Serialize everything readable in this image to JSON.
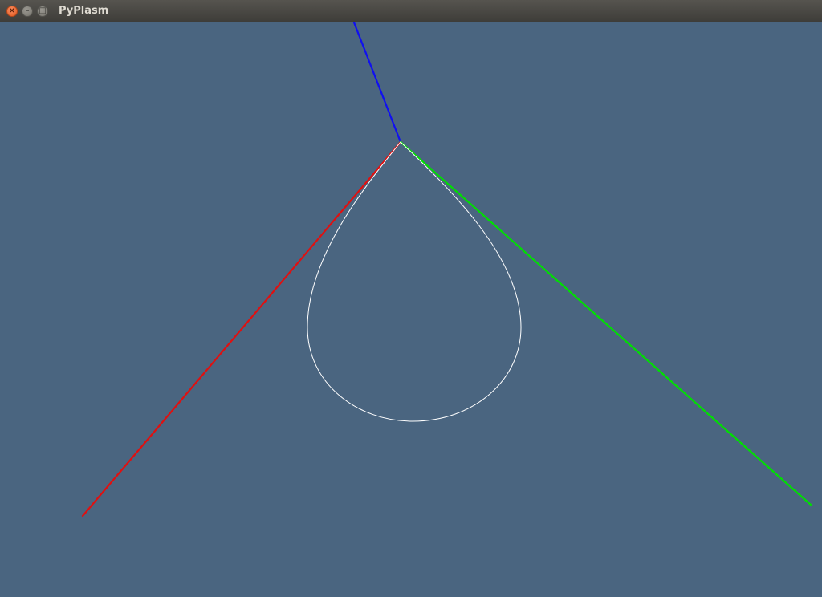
{
  "window": {
    "title": "PyPlasm",
    "buttons": {
      "close": "×",
      "minimize": "–",
      "maximize": "□"
    }
  },
  "viewport": {
    "background_color": "#4a6580",
    "axes": {
      "x": {
        "color": "#e01010"
      },
      "y": {
        "color": "#00e000"
      },
      "z": {
        "color": "#1010f0"
      }
    },
    "curve": {
      "color": "#ffffff",
      "shape": "teardrop"
    }
  }
}
